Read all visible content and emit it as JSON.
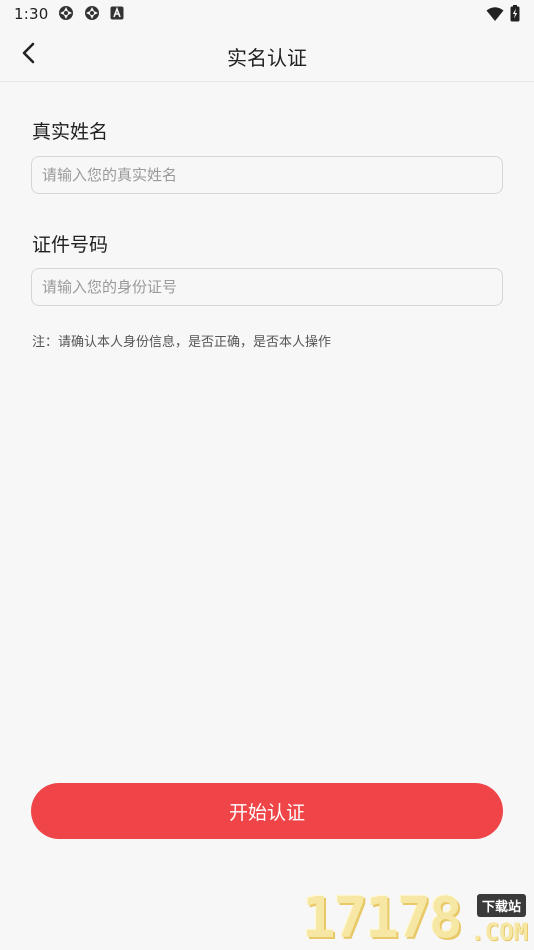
{
  "status_bar": {
    "time": "1:30",
    "icons_left": [
      "settings-icon",
      "settings-icon",
      "keyboard-a-icon"
    ],
    "icons_right": [
      "wifi-icon",
      "battery-charging-icon"
    ]
  },
  "header": {
    "title": "实名认证",
    "back_icon": "chevron-left-icon"
  },
  "form": {
    "name": {
      "label": "真实姓名",
      "placeholder": "请输入您的真实姓名",
      "value": ""
    },
    "id": {
      "label": "证件号码",
      "placeholder": "请输入您的身份证号",
      "value": ""
    },
    "note": "注：请确认本人身份信息，是否正确，是否本人操作"
  },
  "actions": {
    "start_label": "开始认证"
  },
  "watermark": {
    "digits": "17178",
    "tag": "下载站",
    "suffix": ".COM"
  },
  "colors": {
    "accent": "#ef4549",
    "background": "#f7f7f7",
    "border": "#d6d6d6"
  }
}
